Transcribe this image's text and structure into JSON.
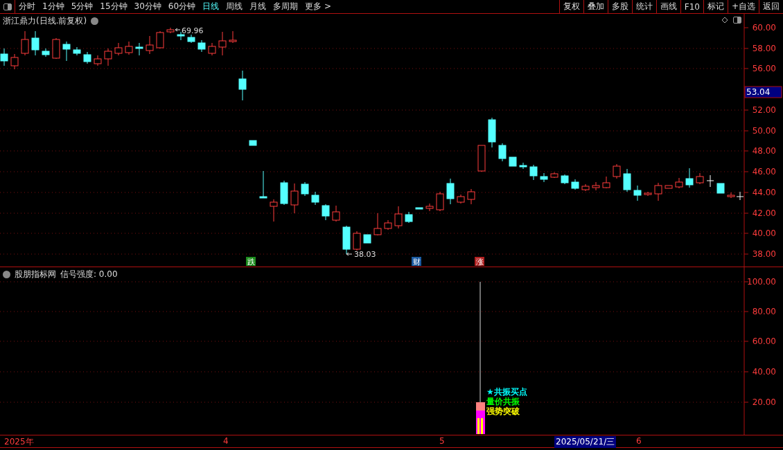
{
  "toolbar": {
    "periods": [
      {
        "label": "分时",
        "selected": false
      },
      {
        "label": "1分钟",
        "selected": false
      },
      {
        "label": "5分钟",
        "selected": false
      },
      {
        "label": "15分钟",
        "selected": false
      },
      {
        "label": "30分钟",
        "selected": false
      },
      {
        "label": "60分钟",
        "selected": false
      },
      {
        "label": "日线",
        "selected": true
      },
      {
        "label": "周线",
        "selected": false
      },
      {
        "label": "月线",
        "selected": false
      },
      {
        "label": "多周期",
        "selected": false
      },
      {
        "label": "更多 >",
        "selected": false
      }
    ],
    "actions": [
      "复权",
      "叠加",
      "多股",
      "统计",
      "画线",
      "F10",
      "标记",
      "+自选",
      "返回"
    ]
  },
  "price_chart": {
    "title": "浙江鼎力(日线.前复权)",
    "axis_labels": [
      "60.00",
      "58.00",
      "56.00",
      "52.00",
      "50.00",
      "48.00",
      "46.00",
      "44.00",
      "42.00",
      "40.00",
      "38.00"
    ],
    "current_price": "53.04",
    "high_label": "69.96",
    "low_label": "38.03",
    "markers": [
      {
        "text": "跌",
        "color": "#1c8c1c"
      },
      {
        "text": "财",
        "color": "#1c5aa0"
      },
      {
        "text": "涨",
        "color": "#b02020"
      }
    ]
  },
  "indicator": {
    "title": "股朋指标网",
    "reading": "信号强度: 0.00",
    "axis_labels": [
      "100.00",
      "80.00",
      "60.00",
      "40.00",
      "20.00"
    ],
    "signals": [
      {
        "text": "★共振买点",
        "color": "#00ffff"
      },
      {
        "text": "量价共振",
        "color": "#00ff00"
      },
      {
        "text": "强势突破",
        "color": "#ffff00"
      }
    ]
  },
  "date_bar": {
    "labels": [
      {
        "text": "2025年",
        "selected": false
      },
      {
        "text": "4",
        "selected": false
      },
      {
        "text": "5",
        "selected": false
      },
      {
        "text": "2025/05/21/三",
        "selected": true
      },
      {
        "text": "6",
        "selected": false
      }
    ]
  }
}
